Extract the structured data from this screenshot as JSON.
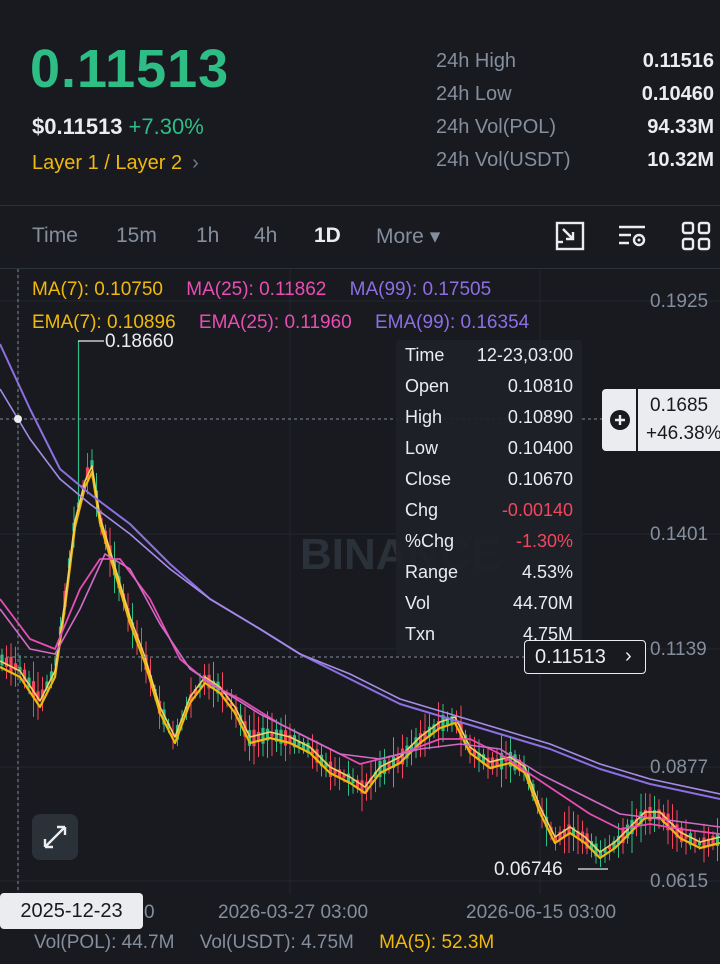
{
  "header": {
    "price": "0.11513",
    "usd_price": "$0.11513",
    "change": "+7.30%",
    "category": "Layer 1 / Layer 2",
    "category_chevron": "›",
    "stats": [
      {
        "label": "24h High",
        "value": "0.11516"
      },
      {
        "label": "24h Low",
        "value": "0.10460"
      },
      {
        "label": "24h Vol(POL)",
        "value": "94.33M"
      },
      {
        "label": "24h Vol(USDT)",
        "value": "10.32M"
      }
    ]
  },
  "intervals": {
    "tabs": [
      "Time",
      "15m",
      "1h",
      "4h",
      "1D",
      "More"
    ],
    "active": "1D",
    "more_caret": "▾",
    "tools": [
      "chart-mode-icon",
      "indicator-settings-icon",
      "layout-grid-icon"
    ]
  },
  "indicators": {
    "ma7": "MA(7): 0.10750",
    "ma25": "MA(25): 0.11862",
    "ma99": "MA(99): 0.17505",
    "ema7": "EMA(7): 0.10896",
    "ema25": "EMA(25): 0.11960",
    "ema99": "EMA(99): 0.16354"
  },
  "tooltip": {
    "rows": [
      {
        "label": "Time",
        "value": "12-23,03:00"
      },
      {
        "label": "Open",
        "value": "0.10810"
      },
      {
        "label": "High",
        "value": "0.10890"
      },
      {
        "label": "Low",
        "value": "0.10400"
      },
      {
        "label": "Close",
        "value": "0.10670"
      },
      {
        "label": "Chg",
        "value": "-0.00140"
      },
      {
        "label": "%Chg",
        "value": "-1.30%"
      },
      {
        "label": "Range",
        "value": "4.53%"
      },
      {
        "label": "Vol",
        "value": "44.70M"
      },
      {
        "label": "Txn",
        "value": "4.75M"
      }
    ]
  },
  "chart": {
    "price_axis": [
      "0.1925",
      "0.1401",
      "0.1139",
      "0.0877",
      "0.0615"
    ],
    "crosshair_price": "0.1685",
    "crosshair_pct": "+46.38%",
    "current_price": "0.11513",
    "current_price_chevron": "›",
    "high_marker": "0.18660",
    "low_marker": "0.06746",
    "watermark": "BINANCE",
    "time_axis": [
      "2026-03-27 03:00",
      "2026-06-15 03:00"
    ],
    "time_axis_partial": "0",
    "crosshair_date": "2025-12-23"
  },
  "volume": {
    "pol": "Vol(POL): 44.7M",
    "usdt": "Vol(USDT): 4.75M",
    "ma5": "MA(5): 52.3M"
  },
  "colors": {
    "up": "#2ebd85",
    "down": "#f6465d",
    "ma7": "#f0b90b",
    "ma25": "#e84db4",
    "ma99": "#8e6ee3",
    "brand": "#f0b90b"
  }
}
